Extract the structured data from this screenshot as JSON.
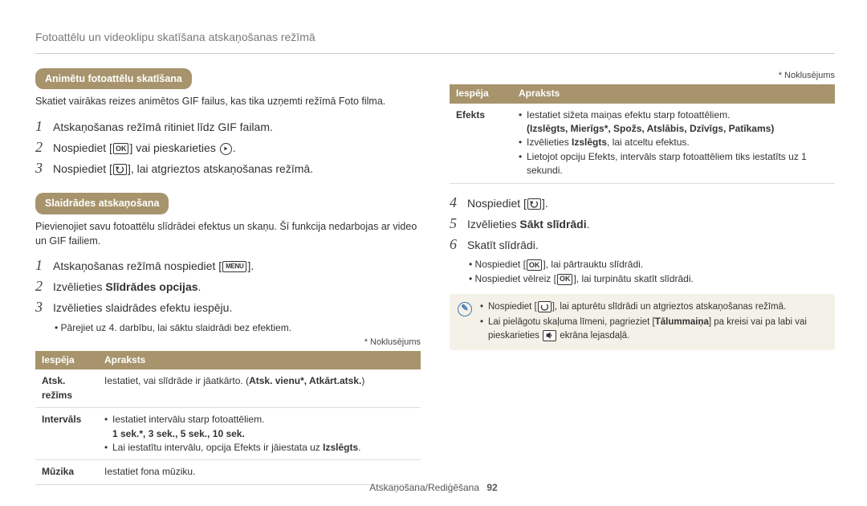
{
  "header": "Fotoattēlu un videoklipu skatīšana atskaņošanas režīmā",
  "section_a": {
    "title": "Animētu fotoattēlu skatīšana",
    "lead": "Skatiet vairākas reizes animētos GIF failus, kas tika uzņemti režīmā Foto filma.",
    "steps": [
      "Atskaņošanas režīmā ritiniet līdz GIF failam.",
      "Nospiediet [OK] vai pieskarieties ▶.",
      "Nospiediet [↶], lai atgrieztos atskaņošanas režīmā."
    ]
  },
  "section_b": {
    "title": "Slaidrādes atskaņošana",
    "lead": "Pievienojiet savu fotoattēlu slīdrādei efektus un skaņu. Šī funkcija nedarbojas ar video un GIF failiem.",
    "steps": {
      "1": "Atskaņošanas režīmā nospiediet [MENU].",
      "2_pre": "Izvēlieties ",
      "2_bold": "Slīdrādes opcijas",
      "3": "Izvēlieties slaidrādes efektu iespēju.",
      "3_note": "Pārejiet uz 4. darbību, lai sāktu slaidrādi bez efektiem."
    },
    "default_note": "* Noklusējums",
    "table": {
      "h1": "Iespēja",
      "h2": "Apraksts",
      "rows": {
        "atsk": {
          "label": "Atsk. režīms",
          "text_pre": "Iestatiet, vai slīdrāde ir jāatkārto. (",
          "text_bold": "Atsk. vienu*, Atkārt.atsk.",
          "text_post": ")"
        },
        "intervals": {
          "label": "Intervāls",
          "b1": "Iestatiet intervālu starp fotoattēliem.",
          "b1_bold": "1 sek.*, 3 sek., 5 sek., 10 sek.",
          "b2_pre": "Lai iestatītu intervālu, opcija Efekts ir jāiestata uz ",
          "b2_bold": "Izslēgts",
          "b2_post": "."
        },
        "muzika": {
          "label": "Mūzika",
          "text": "Iestatiet fona mūziku."
        }
      }
    }
  },
  "right": {
    "default_note": "* Noklusējums",
    "table": {
      "h1": "Iespēja",
      "h2": "Apraksts",
      "efekts": {
        "label": "Efekts",
        "b1": "Iestatiet sižeta maiņas efektu starp fotoattēliem.",
        "b1_bold": "(Izslēgts, Mierīgs*, Spožs, Atslābis, Dzīvīgs, Patīkams)",
        "b2_pre": "Izvēlieties ",
        "b2_bold": "Izslēgts",
        "b2_post": ", lai atceltu efektus.",
        "b3": "Lietojot opciju Efekts, intervāls starp fotoattēliem tiks iestatīts uz 1 sekundi."
      }
    },
    "steps": {
      "4": "Nospiediet [↶].",
      "5_pre": "Izvēlieties ",
      "5_bold": "Sākt slīdrādi",
      "6": "Skatīt slīdrādi.",
      "6_b1": "Nospiediet [OK], lai pārtrauktu slīdrādi.",
      "6_b2": "Nospiediet vēlreiz [OK], lai turpinātu skatīt slīdrādi."
    },
    "note": {
      "b1": "Nospiediet [↶], lai apturētu slīdrādi un atgrieztos atskaņošanas režīmā.",
      "b2_pre": "Lai pielāgotu skaļuma līmeni, pagrieziet [",
      "b2_bold": "Tālummaiņa",
      "b2_mid": "] pa kreisi vai pa labi vai pieskarieties ",
      "b2_post": " ekrāna lejasdaļā."
    }
  },
  "footer": {
    "section": "Atskaņošana/Rediģēšana",
    "page": "92"
  },
  "icons": {
    "ok": "OK",
    "menu": "MENU"
  }
}
